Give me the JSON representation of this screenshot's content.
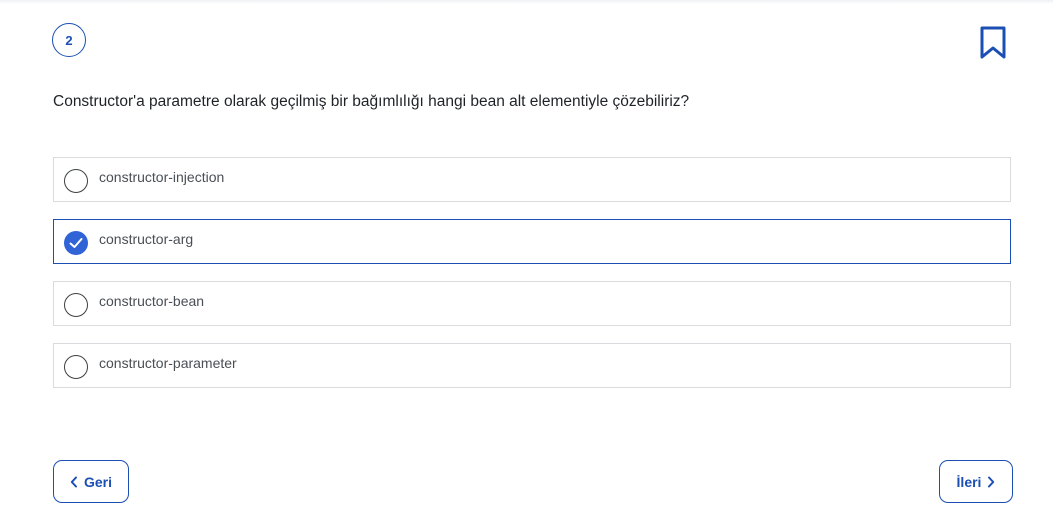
{
  "question": {
    "number": "2",
    "text": "Constructor'a parametre olarak geçilmiş bir bağımlılığı hangi bean alt elementiyle çözebiliriz?"
  },
  "bookmark": {
    "icon": "bookmark-icon"
  },
  "options": [
    {
      "label": "constructor-injection",
      "selected": false
    },
    {
      "label": "constructor-arg",
      "selected": true
    },
    {
      "label": "constructor-bean",
      "selected": false
    },
    {
      "label": "constructor-parameter",
      "selected": false
    }
  ],
  "navigation": {
    "back_label": "Geri",
    "back_icon": "chevron-left-icon",
    "next_label": "İleri",
    "next_icon": "chevron-right-icon"
  },
  "colors": {
    "accent": "#1b4fb3",
    "checked_radio": "#2f63d6",
    "border": "#d9dbde",
    "text": "#1f2328"
  }
}
